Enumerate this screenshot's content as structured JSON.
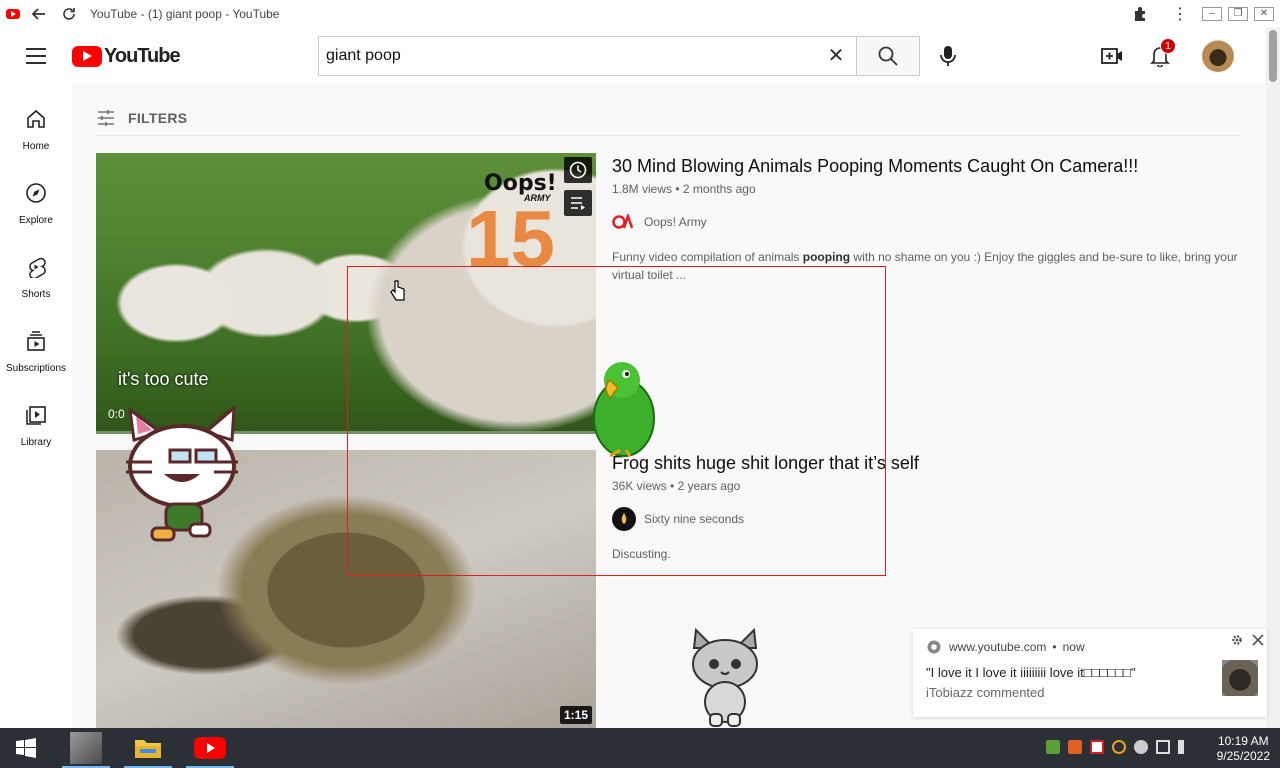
{
  "browser": {
    "tab_title": "YouTube - (1) giant poop - YouTube"
  },
  "header": {
    "logo_text": "YouTube",
    "search": {
      "value": "giant poop",
      "placeholder": "Search"
    },
    "notification_count": "1"
  },
  "guide": {
    "items": [
      {
        "label": "Home",
        "icon": "home-icon"
      },
      {
        "label": "Explore",
        "icon": "compass-icon"
      },
      {
        "label": "Shorts",
        "icon": "shorts-icon"
      },
      {
        "label": "Subscriptions",
        "icon": "subscriptions-icon"
      },
      {
        "label": "Library",
        "icon": "library-icon"
      }
    ]
  },
  "filters": {
    "label": "FILTERS"
  },
  "results": [
    {
      "title": "30 Mind Blowing Animals Pooping Moments Caught On Camera!!!",
      "views": "1.8M views",
      "age": "2 months ago",
      "channel": "Oops! Army",
      "description_before": "Funny video compilation of animals ",
      "description_bold": "pooping",
      "description_after": " with no shame on you :) Enjoy the giggles and be-sure to like, bring your virtual toilet ...",
      "thumb_logo": "Oops!",
      "thumb_logo_sub": "ARMY",
      "thumb_number": "15",
      "caption": "it's too cute",
      "timecode": "0:0"
    },
    {
      "title": "Frog shits huge shit longer that it’s self",
      "views": "36K views",
      "age": "2 years ago",
      "channel": "Sixty nine seconds",
      "description": "Discusting.",
      "duration": "1:15"
    }
  ],
  "toast": {
    "source": "www.youtube.com",
    "time": "now",
    "message": "\"I love it I love it iiiiiiiii love it□□□□□□\"",
    "commenter": "iTobiazz commented"
  },
  "taskbar": {
    "time": "10:19 AM",
    "date": "9/25/2022"
  },
  "colors": {
    "youtube_red": "#ff0000",
    "annotation_red": "#e02020",
    "taskbar": "#2b2f36"
  }
}
